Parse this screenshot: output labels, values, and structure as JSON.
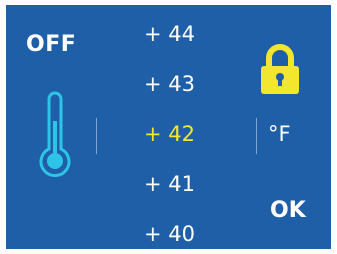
{
  "power": {
    "label": "OFF"
  },
  "temperatures": [
    {
      "label": "+ 44"
    },
    {
      "label": "+ 43"
    },
    {
      "label": "+ 42"
    },
    {
      "label": "+ 41"
    },
    {
      "label": "+ 40"
    }
  ],
  "selected_index": 2,
  "unit": {
    "label": "°F"
  },
  "confirm": {
    "label": "OK"
  },
  "icons": {
    "thermometer": "thermometer-icon",
    "lock": "lock-icon"
  },
  "colors": {
    "background": "#1f5fa8",
    "text": "#ffffff",
    "selected_text": "#f2e62e",
    "thermometer": "#2ec4e8",
    "lock_body": "#f2e62e",
    "lock_keyhole": "#1f5fa8"
  }
}
